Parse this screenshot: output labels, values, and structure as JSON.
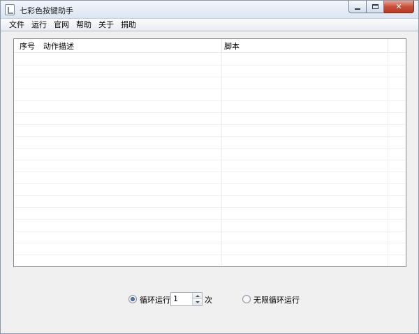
{
  "window": {
    "title": "七彩色按键助手",
    "icon": "app-icon"
  },
  "menu": {
    "items": [
      "文件",
      "运行",
      "官网",
      "帮助",
      "关于",
      "捐助"
    ]
  },
  "table": {
    "columns": [
      "序号",
      "动作描述",
      "脚本"
    ],
    "rows": []
  },
  "controls": {
    "loop_label": "循环运行",
    "loop_count": "1",
    "times_label": "次",
    "infinite_label": "无限循环运行",
    "selected": "loop"
  },
  "colors": {
    "titlebar": "#dbe5f1",
    "close_button": "#c8503a",
    "window_bg": "#f0f0f0"
  }
}
